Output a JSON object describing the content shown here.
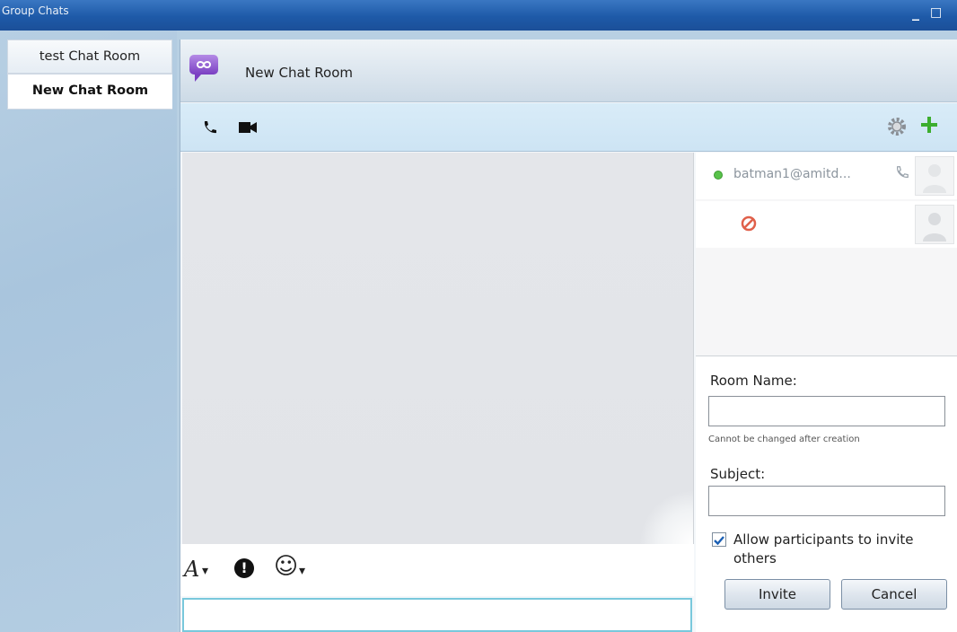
{
  "window": {
    "title": "Group Chats",
    "minimize": "_",
    "maximize": "□"
  },
  "sidebar": {
    "rooms": [
      {
        "label": "test Chat Room",
        "active": false
      },
      {
        "label": "New Chat Room",
        "active": true
      }
    ]
  },
  "room": {
    "title": "New Chat Room",
    "icon": "chat-room-icon"
  },
  "toolbar": {
    "left_icons": [
      "phone-icon",
      "video-camera-icon"
    ],
    "right_icons": [
      "gear-icon",
      "add-participant-icon"
    ]
  },
  "participants": [
    {
      "name": "batman1@amitd...",
      "status": "online",
      "icons": [
        "phone-icon",
        "avatar"
      ]
    },
    {
      "name": "",
      "status": "blocked",
      "icons": [
        "blocked-icon",
        "avatar"
      ]
    }
  ],
  "format_bar": {
    "font": "A",
    "dropdown": "▾",
    "important": "!",
    "emoticon": "☺"
  },
  "form": {
    "room_name_label": "Room Name:",
    "room_name_value": "",
    "room_name_note": "Cannot be changed after creation",
    "subject_label": "Subject:",
    "subject_value": "",
    "allow_invite_label": "Allow participants to invite others",
    "allow_invite_checked": true,
    "invite_button": "Invite",
    "cancel_button": "Cancel"
  },
  "colors": {
    "titlebar": "#1e5aa8",
    "accent_green": "#3cae2e",
    "presence_online": "#58c24a",
    "blocked_red": "#e0604a",
    "input_focus": "#79c8dc"
  }
}
